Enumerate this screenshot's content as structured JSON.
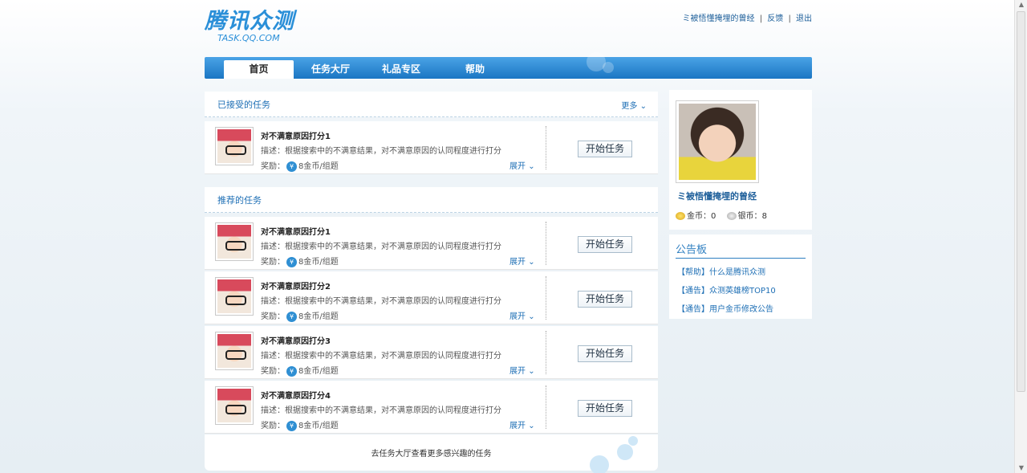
{
  "header": {
    "logo_main": "腾讯众测",
    "logo_sub": "TASK.QQ.COM",
    "user_link": "ミ被悟懂掩埋的曾经",
    "feedback": "反馈",
    "logout": "退出",
    "sep": "|"
  },
  "nav": {
    "tabs": [
      {
        "label": "首页"
      },
      {
        "label": "任务大厅"
      },
      {
        "label": "礼品专区"
      },
      {
        "label": "帮助"
      }
    ]
  },
  "accepted": {
    "title": "已接受的任务",
    "more": "更多",
    "more_icon": "chevron-down-icon",
    "tasks": [
      {
        "name": "对不满意原因打分1",
        "desc": "描述：根据搜索中的不满意结果，对不满意原因的认同程度进行打分",
        "reward_label": "奖励：",
        "reward": "8金币/组题",
        "expand": "展开",
        "button": "开始任务"
      }
    ]
  },
  "recommended": {
    "title": "推荐的任务",
    "tasks": [
      {
        "name": "对不满意原因打分1",
        "desc": "描述：根据搜索中的不满意结果，对不满意原因的认同程度进行打分",
        "reward_label": "奖励：",
        "reward": "8金币/组题",
        "expand": "展开",
        "button": "开始任务"
      },
      {
        "name": "对不满意原因打分2",
        "desc": "描述：根据搜索中的不满意结果，对不满意原因的认同程度进行打分",
        "reward_label": "奖励：",
        "reward": "8金币/组题",
        "expand": "展开",
        "button": "开始任务"
      },
      {
        "name": "对不满意原因打分3",
        "desc": "描述：根据搜索中的不满意结果，对不满意原因的认同程度进行打分",
        "reward_label": "奖励：",
        "reward": "8金币/组题",
        "expand": "展开",
        "button": "开始任务"
      },
      {
        "name": "对不满意原因打分4",
        "desc": "描述：根据搜索中的不满意结果，对不满意原因的认同程度进行打分",
        "reward_label": "奖励：",
        "reward": "8金币/组题",
        "expand": "展开",
        "button": "开始任务"
      }
    ],
    "footer_link": "去任务大厅查看更多感兴趣的任务"
  },
  "profile": {
    "username": "ミ被悟懂掩埋的曾经",
    "gold_label": "金币：",
    "gold": "0",
    "silver_label": "银币：",
    "silver": "8"
  },
  "notice": {
    "title": "公告板",
    "items": [
      {
        "label": "【帮助】什么是腾讯众测"
      },
      {
        "label": "【通告】众测英雄榜TOP10"
      },
      {
        "label": "【通告】用户金币修改公告"
      }
    ]
  },
  "colors": {
    "accent": "#1b76c3",
    "link": "#1e6fb5"
  }
}
